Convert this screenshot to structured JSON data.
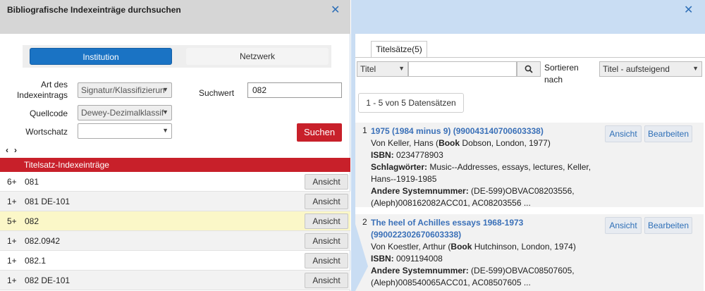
{
  "left_panel": {
    "title": "Bibliografische Indexeinträge durchsuchen",
    "toggle": {
      "institution": "Institution",
      "network": "Netzwerk"
    },
    "form": {
      "index_type_label": "Art des Indexeintrags",
      "index_type_value": "Signatur/Klassifizierun",
      "source_code_label": "Quellcode",
      "source_code_value": "Dewey-Dezimalklassif",
      "vocabulary_label": "Wortschatz",
      "vocabulary_value": "",
      "search_value_label": "Suchwert",
      "search_value": "082",
      "search_button": "Suchen"
    },
    "pager": {
      "prev": "‹",
      "next": "›"
    },
    "section_title": "Titelsatz-Indexeinträge",
    "rows": [
      {
        "count": "6+",
        "term": "081",
        "button": "Ansicht"
      },
      {
        "count": "1+",
        "term": "081 DE-101",
        "button": "Ansicht"
      },
      {
        "count": "5+",
        "term": "082",
        "button": "Ansicht"
      },
      {
        "count": "1+",
        "term": "082.0942",
        "button": "Ansicht"
      },
      {
        "count": "1+",
        "term": "082.1",
        "button": "Ansicht"
      },
      {
        "count": "1+",
        "term": "082 DE-101",
        "button": "Ansicht"
      }
    ]
  },
  "right_panel": {
    "tab_label": "Titelsätze(5)",
    "search_field_value": "Titel",
    "sort_label_line1": "Sortieren",
    "sort_label_line2": "nach",
    "sort_value": "Titel - aufsteigend",
    "count_text": "1 - 5 von 5 Datensätzen",
    "records": [
      {
        "num": "1",
        "title": "1975 (1984 minus 9) (990043140700603338)",
        "author_pre": "Von Keller, Hans (",
        "author_bold": "Book",
        "author_post": " Dobson, London, 1977)",
        "isbn_label": "ISBN:",
        "isbn": " 0234778903",
        "subjects_label": "Schlagwörter:",
        "subjects": " Music--Addresses, essays, lectures, Keller, Hans--1919-1985",
        "other_label": "Andere Systemnummer:",
        "other": " (DE-599)OBVAC08203556, (Aleph)008162082ACC01, AC08203556 ...",
        "view_button": "Ansicht",
        "edit_button": "Bearbeiten"
      },
      {
        "num": "2",
        "title": "The heel of Achilles essays 1968-1973 (990022302670603338)",
        "author_pre": "Von Koestler, Arthur (",
        "author_bold": "Book",
        "author_post": " Hutchinson, London, 1974)",
        "isbn_label": "ISBN:",
        "isbn": " 0091194008",
        "other_label": "Andere Systemnummer:",
        "other": " (DE-599)OBVAC08507605, (Aleph)008540065ACC01, AC08507605 ...",
        "view_button": "Ansicht",
        "edit_button": "Bearbeiten"
      }
    ]
  },
  "colors": {
    "accent_blue": "#1a73c4",
    "accent_red": "#c8202a",
    "link_blue": "#3a70b8",
    "highlight_yellow": "#fbf7c8",
    "right_bg": "#c9ddf3"
  },
  "icons": {
    "close": "close-icon",
    "search": "search-icon",
    "chevron": "chevron-down-icon"
  }
}
